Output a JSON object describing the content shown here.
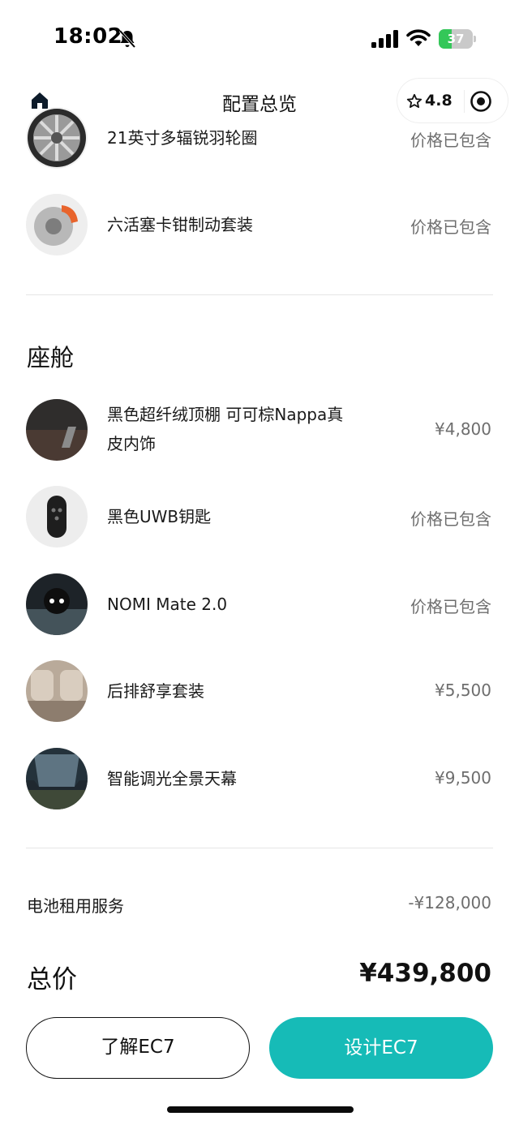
{
  "status_bar": {
    "time": "18:02",
    "battery_percent": "37",
    "battery_level": 0.37,
    "icons": [
      "bell-muted-icon",
      "signal-icon",
      "wifi-icon",
      "battery-charging-icon"
    ]
  },
  "nav": {
    "title": "配置总览",
    "rating": "4.8",
    "icons": [
      "home-icon",
      "star-icon",
      "target-icon"
    ]
  },
  "wheels_brakes": [
    {
      "label": "21英寸多辐锐羽轮圈",
      "price": "价格已包含",
      "icon": "wheel-thumbnail"
    },
    {
      "label": "六活塞卡钳制动套装",
      "price": "价格已包含",
      "icon": "brake-thumbnail"
    }
  ],
  "cabin": {
    "title": "座舱",
    "items": [
      {
        "label_line1": "黑色超纤绒顶棚 可可棕Nappa真",
        "label_line2": "皮内饰",
        "price": "¥4,800",
        "icon": "interior-thumbnail"
      },
      {
        "label": "黑色UWB钥匙",
        "price": "价格已包含",
        "icon": "key-fob-thumbnail"
      },
      {
        "label": "NOMI Mate 2.0",
        "price": "价格已包含",
        "icon": "nomi-thumbnail"
      },
      {
        "label": "后排舒享套装",
        "price": "¥5,500",
        "icon": "rear-seat-thumbnail"
      },
      {
        "label": "智能调光全景天幕",
        "price": "¥9,500",
        "icon": "sunroof-thumbnail"
      }
    ]
  },
  "battery_service": {
    "label": "电池租用服务",
    "value": "-¥128,000"
  },
  "total": {
    "label": "总价",
    "value": "¥439,800"
  },
  "buttons": {
    "learn": "了解EC7",
    "design": "设计EC7"
  },
  "colors": {
    "accent": "#16bbb7",
    "text": "#1a1a1a",
    "muted": "#6e6e6e",
    "battery": "#34c759"
  }
}
